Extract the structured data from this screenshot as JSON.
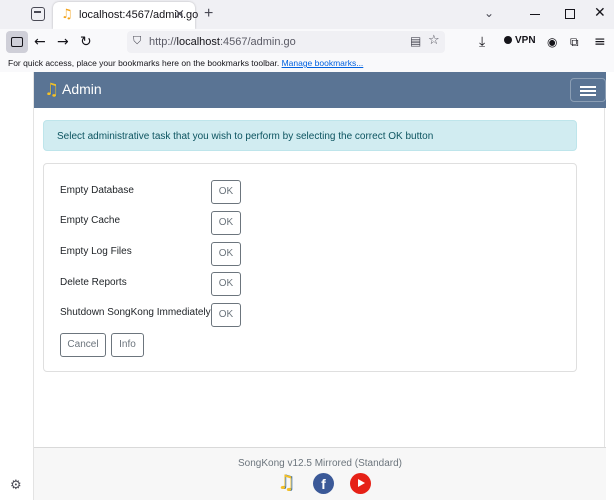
{
  "browser": {
    "tab": {
      "title": "localhost:4567/admin.go"
    },
    "url": {
      "scheme": "http://",
      "host": "localhost",
      "rest": ":4567/admin.go"
    },
    "vpn_label": "VPN",
    "bookmarks_bar": {
      "text": "For quick access, place your bookmarks here on the bookmarks toolbar.",
      "link": "Manage bookmarks..."
    }
  },
  "app": {
    "brand": "Admin",
    "alert": "Select administrative task that you wish to perform by selecting the correct OK button",
    "tasks": [
      {
        "label": "Empty Database",
        "button": "OK"
      },
      {
        "label": "Empty Cache",
        "button": "OK"
      },
      {
        "label": "Empty Log Files",
        "button": "OK"
      },
      {
        "label": "Delete Reports",
        "button": "OK"
      },
      {
        "label": "Shutdown SongKong Immediately",
        "button": "OK"
      }
    ],
    "cancel_label": "Cancel",
    "info_label": "Info",
    "footer": {
      "version": "SongKong v12.5 Mirrored (Standard)"
    }
  },
  "colors": {
    "navbar": "#5a7494",
    "alert_bg": "#d1ecf1",
    "alert_text": "#0c5460",
    "button_border": "#6c757d"
  },
  "icons": [
    "tab-list-icon",
    "songkong-favicon",
    "close-icon",
    "plus-icon",
    "chevron-down-icon",
    "minimize-icon",
    "maximize-icon",
    "sidebar-icon",
    "back-icon",
    "forward-icon",
    "reload-icon",
    "shield-icon",
    "reader-view-icon",
    "bookmark-star-icon",
    "download-icon",
    "vpn-icon",
    "extensions-icon",
    "account-icon",
    "menu-icon",
    "hamburger-icon",
    "facebook-icon",
    "youtube-icon",
    "gear-icon"
  ]
}
